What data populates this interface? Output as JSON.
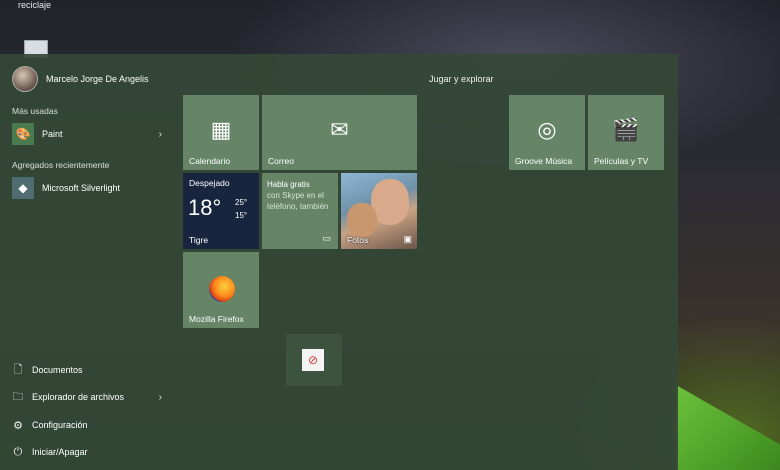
{
  "desktop": {
    "label": "reciclaje"
  },
  "user": {
    "name": "Marcelo Jorge De Angelis"
  },
  "most_used": {
    "header": "Más usadas",
    "items": [
      {
        "label": "Paint",
        "icon": "paint-icon",
        "has_submenu": true
      }
    ]
  },
  "recent": {
    "header": "Agregados recientemente",
    "items": [
      {
        "label": "Microsoft Silverlight",
        "icon": "silverlight-icon"
      }
    ]
  },
  "bottom": {
    "documents": "Documentos",
    "explorer": "Explorador de archivos",
    "settings": "Configuración",
    "power": "Iniciar/Apagar"
  },
  "groups": {
    "play": "Jugar y explorar"
  },
  "tiles": {
    "calendar": "Calendario",
    "mail": "Correo",
    "weather": {
      "condition": "Despejado",
      "temp": "18°",
      "high": "25°",
      "low": "15°",
      "location": "Tigre"
    },
    "skype": {
      "title": "Habla gratis",
      "body": "con Skype en el teléfono, también"
    },
    "photos": "Fotos",
    "firefox": "Mozilla Firefox",
    "groove": "Groove Música",
    "movies": "Películas y TV"
  },
  "colors": {
    "tile": "#6e916e",
    "menu_bg": "#344837",
    "weather_bg": "#18253f"
  }
}
